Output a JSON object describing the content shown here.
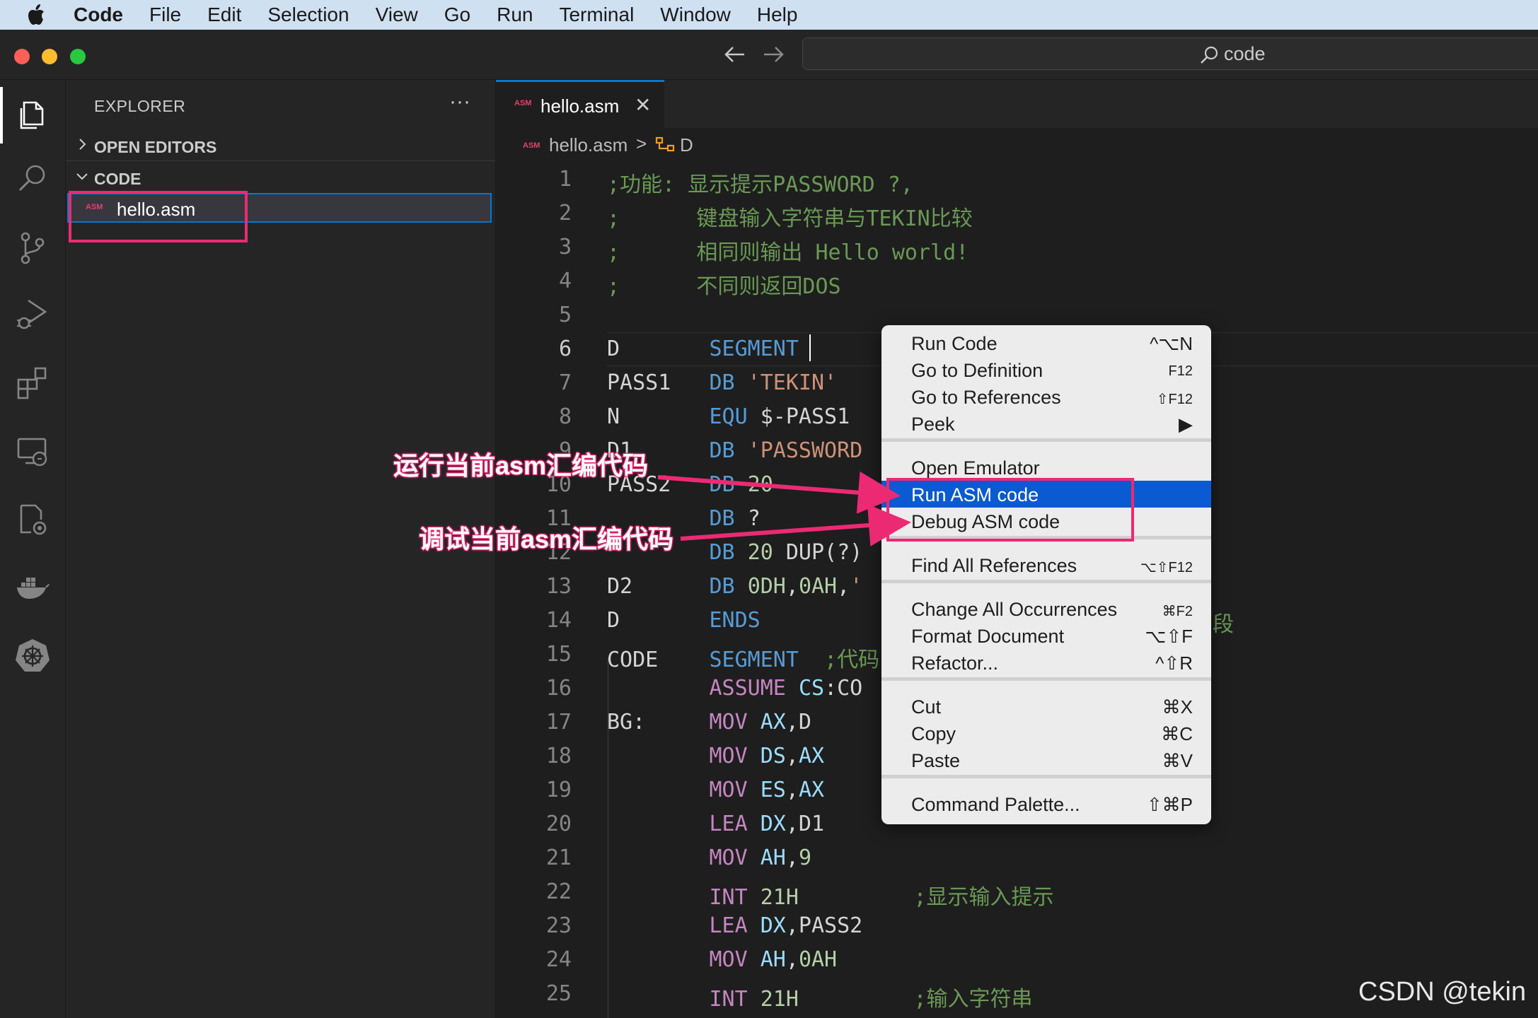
{
  "menubar": {
    "app": "Code",
    "items": [
      "File",
      "Edit",
      "Selection",
      "View",
      "Go",
      "Run",
      "Terminal",
      "Window",
      "Help"
    ]
  },
  "titlebar": {
    "search_text": "code",
    "back_icon": "arrow-left-icon",
    "forward_icon": "arrow-right-icon"
  },
  "activity_bar": {
    "icons": [
      "explorer-icon",
      "search-icon",
      "source-control-icon",
      "run-debug-icon",
      "extensions-icon",
      "remote-explorer-icon",
      "settings-sync-icon",
      "docker-icon",
      "kubernetes-icon"
    ]
  },
  "sidebar": {
    "title": "EXPLORER",
    "more": "···",
    "sections": {
      "open_editors": "OPEN EDITORS",
      "folder": "CODE"
    },
    "file": {
      "badge": "ASM",
      "name": "hello.asm"
    }
  },
  "tabs": [
    {
      "badge": "ASM",
      "label": "hello.asm",
      "close": "✕"
    }
  ],
  "breadcrumb": {
    "badge": "ASM",
    "file": "hello.asm",
    "separator": ">",
    "symbol": "D"
  },
  "editor": {
    "current_line": 6,
    "lines": [
      {
        "n": "1",
        "parts": [
          {
            "c": "com",
            "t": ";功能: 显示提示PASSWORD ?,"
          }
        ]
      },
      {
        "n": "2",
        "parts": [
          {
            "c": "com",
            "t": ";      键盘输入字符串与TEKIN比较"
          }
        ]
      },
      {
        "n": "3",
        "parts": [
          {
            "c": "com",
            "t": ";      相同则输出 Hello world!"
          }
        ]
      },
      {
        "n": "4",
        "parts": [
          {
            "c": "com",
            "t": ";      不同则返回DOS"
          }
        ]
      },
      {
        "n": "5",
        "parts": []
      },
      {
        "n": "6",
        "parts": [
          {
            "c": "label",
            "t": "D       "
          },
          {
            "c": "kw",
            "t": "SEGMENT"
          }
        ]
      },
      {
        "n": "7",
        "parts": [
          {
            "c": "label",
            "t": "PASS1   "
          },
          {
            "c": "kw",
            "t": "DB "
          },
          {
            "c": "str",
            "t": "'TEKIN'"
          }
        ]
      },
      {
        "n": "8",
        "parts": [
          {
            "c": "label",
            "t": "N       "
          },
          {
            "c": "kw",
            "t": "EQU "
          },
          {
            "c": "txt",
            "t": "$-PASS1"
          }
        ]
      },
      {
        "n": "9",
        "parts": [
          {
            "c": "label",
            "t": "D1      "
          },
          {
            "c": "kw",
            "t": "DB "
          },
          {
            "c": "str",
            "t": "'PASSWORD"
          }
        ]
      },
      {
        "n": "10",
        "parts": [
          {
            "c": "label",
            "t": "PASS2   "
          },
          {
            "c": "kw",
            "t": "DB "
          },
          {
            "c": "num",
            "t": "20"
          }
        ]
      },
      {
        "n": "11",
        "parts": [
          {
            "c": "label",
            "t": "        "
          },
          {
            "c": "kw",
            "t": "DB "
          },
          {
            "c": "txt",
            "t": "?"
          }
        ]
      },
      {
        "n": "12",
        "parts": [
          {
            "c": "label",
            "t": "        "
          },
          {
            "c": "kw",
            "t": "DB "
          },
          {
            "c": "num",
            "t": "20 "
          },
          {
            "c": "txt",
            "t": "DUP(?)"
          }
        ]
      },
      {
        "n": "13",
        "parts": [
          {
            "c": "label",
            "t": "D2      "
          },
          {
            "c": "kw",
            "t": "DB "
          },
          {
            "c": "num",
            "t": "0DH"
          },
          {
            "c": "txt",
            "t": ","
          },
          {
            "c": "num",
            "t": "0AH"
          },
          {
            "c": "txt",
            "t": ","
          },
          {
            "c": "str",
            "t": "'"
          }
        ]
      },
      {
        "n": "14",
        "parts": [
          {
            "c": "label",
            "t": "D       "
          },
          {
            "c": "kw",
            "t": "ENDS"
          }
        ]
      },
      {
        "n": "15",
        "parts": [
          {
            "c": "label",
            "t": "CODE    "
          },
          {
            "c": "kw",
            "t": "SEGMENT  "
          },
          {
            "c": "com",
            "t": ";代码"
          }
        ]
      },
      {
        "n": "16",
        "parts": [
          {
            "c": "label",
            "t": "        "
          },
          {
            "c": "op",
            "t": "ASSUME "
          },
          {
            "c": "reg",
            "t": "CS"
          },
          {
            "c": "txt",
            "t": ":CO"
          }
        ]
      },
      {
        "n": "17",
        "parts": [
          {
            "c": "label",
            "t": "BG:     "
          },
          {
            "c": "op",
            "t": "MOV "
          },
          {
            "c": "reg",
            "t": "AX"
          },
          {
            "c": "txt",
            "t": ",D"
          }
        ]
      },
      {
        "n": "18",
        "parts": [
          {
            "c": "label",
            "t": "        "
          },
          {
            "c": "op",
            "t": "MOV "
          },
          {
            "c": "reg",
            "t": "DS"
          },
          {
            "c": "txt",
            "t": ","
          },
          {
            "c": "reg",
            "t": "AX"
          }
        ]
      },
      {
        "n": "19",
        "parts": [
          {
            "c": "label",
            "t": "        "
          },
          {
            "c": "op",
            "t": "MOV "
          },
          {
            "c": "reg",
            "t": "ES"
          },
          {
            "c": "txt",
            "t": ","
          },
          {
            "c": "reg",
            "t": "AX"
          }
        ]
      },
      {
        "n": "20",
        "parts": [
          {
            "c": "label",
            "t": "        "
          },
          {
            "c": "op",
            "t": "LEA "
          },
          {
            "c": "reg",
            "t": "DX"
          },
          {
            "c": "txt",
            "t": ",D1"
          }
        ]
      },
      {
        "n": "21",
        "parts": [
          {
            "c": "label",
            "t": "        "
          },
          {
            "c": "op",
            "t": "MOV "
          },
          {
            "c": "reg",
            "t": "AH"
          },
          {
            "c": "txt",
            "t": ","
          },
          {
            "c": "num",
            "t": "9"
          }
        ]
      },
      {
        "n": "22",
        "parts": [
          {
            "c": "label",
            "t": "        "
          },
          {
            "c": "op",
            "t": "INT "
          },
          {
            "c": "num",
            "t": "21H"
          },
          {
            "c": "txt",
            "t": "         "
          },
          {
            "c": "com",
            "t": ";显示输入提示"
          }
        ]
      },
      {
        "n": "23",
        "parts": [
          {
            "c": "label",
            "t": "        "
          },
          {
            "c": "op",
            "t": "LEA "
          },
          {
            "c": "reg",
            "t": "DX"
          },
          {
            "c": "txt",
            "t": ",PASS2"
          }
        ]
      },
      {
        "n": "24",
        "parts": [
          {
            "c": "label",
            "t": "        "
          },
          {
            "c": "op",
            "t": "MOV "
          },
          {
            "c": "reg",
            "t": "AH"
          },
          {
            "c": "txt",
            "t": ","
          },
          {
            "c": "num",
            "t": "0AH"
          }
        ]
      },
      {
        "n": "25",
        "parts": [
          {
            "c": "label",
            "t": "        "
          },
          {
            "c": "op",
            "t": "INT "
          },
          {
            "c": "num",
            "t": "21H"
          },
          {
            "c": "txt",
            "t": "         "
          },
          {
            "c": "com",
            "t": ";输入字符串"
          }
        ]
      }
    ],
    "overflow_char": "段"
  },
  "context_menu": {
    "groups": [
      [
        {
          "label": "Run Code",
          "shortcut": "^⌥N"
        },
        {
          "label": "Go to Definition",
          "shortcut": "F12",
          "small": true
        },
        {
          "label": "Go to References",
          "shortcut": "⇧F12",
          "small": true
        },
        {
          "label": "Peek",
          "shortcut": "▶"
        }
      ],
      [
        {
          "label": "Open Emulator",
          "shortcut": ""
        },
        {
          "label": "Run ASM code",
          "shortcut": "",
          "highlight": true
        },
        {
          "label": "Debug ASM code",
          "shortcut": ""
        }
      ],
      [
        {
          "label": "Find All References",
          "shortcut": "⌥⇧F12",
          "small": true
        }
      ],
      [
        {
          "label": "Change All Occurrences",
          "shortcut": "⌘F2",
          "small": true
        },
        {
          "label": "Format Document",
          "shortcut": "⌥⇧F"
        },
        {
          "label": "Refactor...",
          "shortcut": "^⇧R"
        }
      ],
      [
        {
          "label": "Cut",
          "shortcut": "⌘X"
        },
        {
          "label": "Copy",
          "shortcut": "⌘C"
        },
        {
          "label": "Paste",
          "shortcut": "⌘V"
        }
      ],
      [
        {
          "label": "Command Palette...",
          "shortcut": "⇧⌘P"
        }
      ]
    ]
  },
  "annotations": {
    "run": "运行当前asm汇编代码",
    "debug": "调试当前asm汇编代码",
    "color": "#ec2a73"
  },
  "watermark": "CSDN @tekin"
}
